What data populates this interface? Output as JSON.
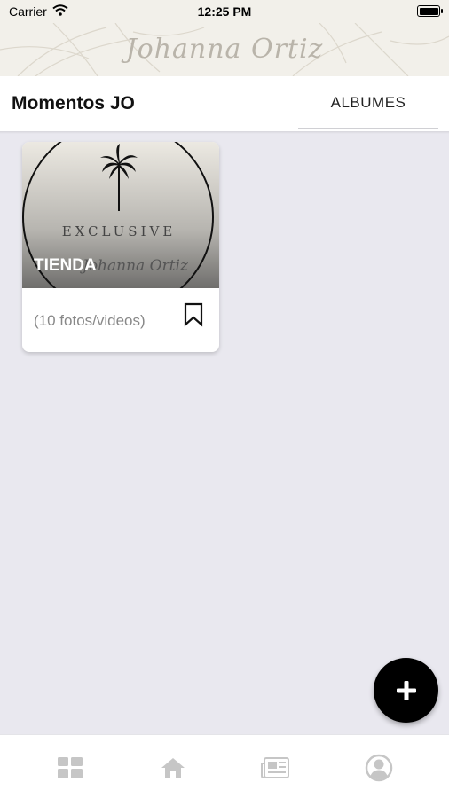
{
  "status_bar": {
    "carrier": "Carrier",
    "time": "12:25 PM"
  },
  "brand": {
    "logo_text": "Johanna Ortiz"
  },
  "header": {
    "title": "Momentos JO",
    "tab_label": "ALBUMES"
  },
  "album": {
    "title": "TIENDA",
    "count": "(10 fotos/videos)",
    "cover_text": "EXCLUSIVE",
    "cover_signature": "Johanna Ortiz"
  },
  "fab_icon": "plus-icon",
  "tabbar": {
    "items": [
      {
        "icon": "grid-icon"
      },
      {
        "icon": "home-icon"
      },
      {
        "icon": "news-icon"
      },
      {
        "icon": "profile-icon"
      }
    ],
    "icon_color": "#c6c6c6"
  },
  "colors": {
    "background": "#e9e8ef",
    "fab": "#000000",
    "brand_bar": "#f2f0ea"
  }
}
